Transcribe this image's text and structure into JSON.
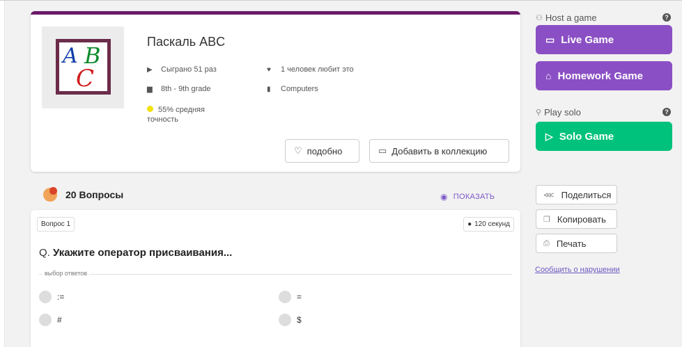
{
  "quiz": {
    "title": "Паскаль ABC",
    "played": "Сыграно 51 раз",
    "likes": "1 человек любит это",
    "grade": "8th - 9th grade",
    "subject": "Computers",
    "accuracy": "55% средняя точность",
    "like_button": "подобно",
    "add_collection_button": "Добавить в коллекцию",
    "thumbnail_letters": [
      "A",
      "B",
      "C"
    ]
  },
  "questions_header": {
    "count_label": "20 Вопросы",
    "show_label": "ПОКАЗАТЬ"
  },
  "question": {
    "number_label": "Вопрос 1",
    "time_label": "120 секунд",
    "prefix": "Q.",
    "text": "Укажите оператор присваивания...",
    "answers_label": "выбор ответов",
    "options": [
      ":=",
      "=",
      "#",
      "$"
    ]
  },
  "sidebar": {
    "host_label": "Host a game",
    "help_symbol": "?",
    "live_game": "Live Game",
    "homework_game": "Homework Game",
    "solo_label": "Play solo",
    "solo_game": "Solo Game",
    "share": "Поделиться",
    "copy": "Копировать",
    "print": "Печать",
    "report": "Сообщить о нарушении"
  },
  "colors": {
    "purple": "#8a4fc4",
    "green": "#00c27c",
    "card_accent": "#6c1a6a",
    "link": "#7b57c8",
    "accuracy_dot": "#f2e20b"
  }
}
